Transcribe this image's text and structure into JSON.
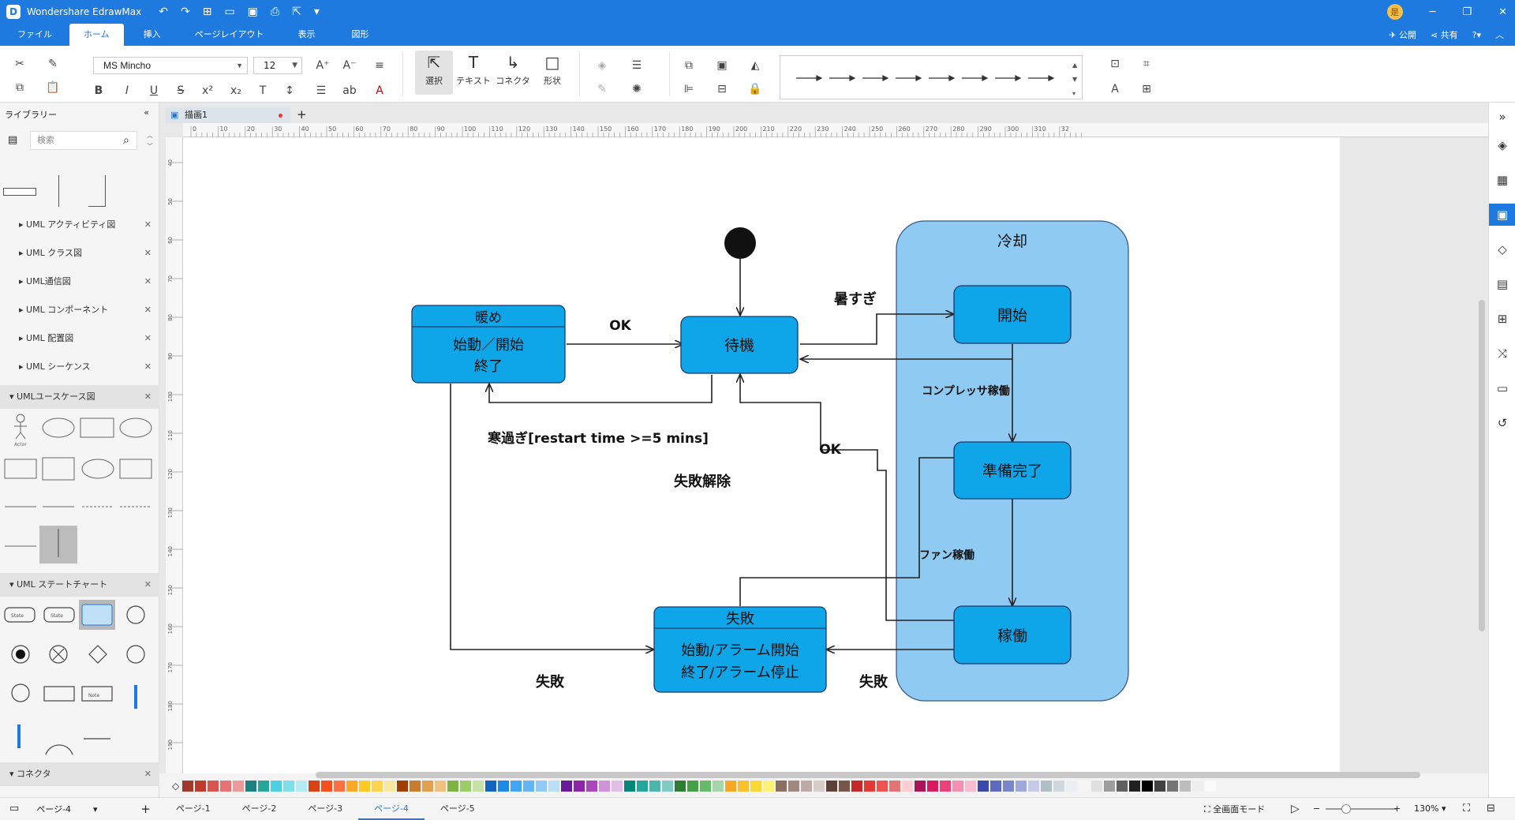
{
  "app": {
    "title": "Wondershare EdrawMax",
    "logo_letter": "D",
    "avatar": "是"
  },
  "menu": {
    "tabs": [
      "ファイル",
      "ホーム",
      "挿入",
      "ページレイアウト",
      "表示",
      "図形"
    ],
    "publish": "公開",
    "share": "共有"
  },
  "ribbon": {
    "font": "MS Mincho",
    "size": "12",
    "tools": {
      "select": "選択",
      "text": "テキスト",
      "connector": "コネクタ",
      "shape": "形状"
    }
  },
  "sidebar": {
    "title": "ライブラリー",
    "search_placeholder": "検索",
    "items": [
      "UML アクティビティ図",
      "UML クラス図",
      "UML通信図",
      "UML コンポーネント",
      "UML 配置図",
      "UML シーケンス"
    ],
    "usecase": "UMLユースケース図",
    "statechart": "UML ステートチャート",
    "connector": "コネクタ",
    "thumb_actor": "Actor",
    "thumb_note": "Note",
    "thumb_state": "State"
  },
  "document": {
    "tab": "描画1"
  },
  "ruler_labels": [
    "0",
    "10",
    "20",
    "30",
    "40",
    "50",
    "60",
    "70",
    "80",
    "90",
    "100",
    "110",
    "120",
    "130",
    "140",
    "150",
    "160",
    "170",
    "180",
    "190",
    "200",
    "210",
    "220",
    "230",
    "240",
    "250",
    "260",
    "270",
    "280",
    "290",
    "300",
    "310",
    "32"
  ],
  "ruler_v_labels": [
    "40",
    "50",
    "60",
    "70",
    "80",
    "90",
    "100",
    "110",
    "120",
    "130",
    "140",
    "150",
    "160",
    "170",
    "180",
    "190"
  ],
  "diagram": {
    "cooling_title": "冷却",
    "warm_title": "暖め",
    "warm_body1": "始動／開始",
    "warm_body2": "終了",
    "standby": "待機",
    "start": "開始",
    "ready": "準備完了",
    "running": "稼働",
    "fail_title": "失敗",
    "fail_body1": "始動/アラーム開始",
    "fail_body2": "終了/アラーム停止",
    "lbl_ok1": "OK",
    "lbl_hot": "暑すぎ",
    "lbl_compressor": "コンプレッサ稼働",
    "lbl_cold": "寒過ぎ[restart time >=5 mins]",
    "lbl_ok2": "OK",
    "lbl_fail_clear": "失敗解除",
    "lbl_fan": "ファン稼働",
    "lbl_fail1": "失敗",
    "lbl_fail2": "失敗"
  },
  "status": {
    "page_select": "ページ-4",
    "pages": [
      "ページ-1",
      "ページ-2",
      "ページ-3",
      "ページ-4",
      "ページ-5"
    ],
    "fullscreen": "全画面モード",
    "zoom": "130%"
  },
  "colors": {
    "accent": "#1f7ae0",
    "state_fill": "#0ea5e9",
    "composite_fill": "#8fcaf2"
  }
}
